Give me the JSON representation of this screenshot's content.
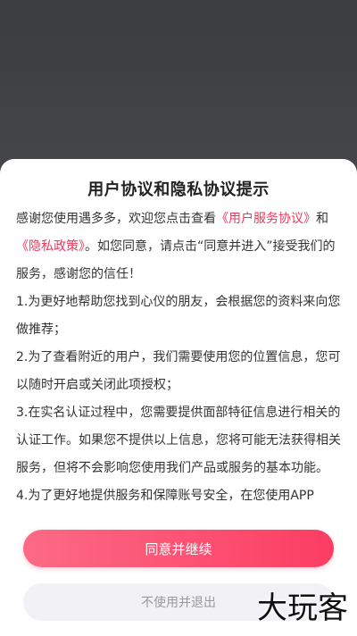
{
  "dialog": {
    "title": "用户协议和隐私协议提示",
    "intro": {
      "text_1": "感谢您使用遇多多，欢迎您点击查看",
      "link_user_agreement": "《用户服务协议》",
      "text_2": "和",
      "link_privacy_policy": "《隐私政策》",
      "text_3": "。如您同意，请点击“同意并进入”接受我们的服务，感谢您的信任！"
    },
    "items": [
      "1.为更好地帮助您找到心仪的朋友，会根据您的资料来向您做推荐；",
      "2.为了查看附近的用户，我们需要使用您的位置信息，您可以随时开启或关闭此项授权；",
      "3.在实名认证过程中，您需要提供面部特征信息进行相关的认证工作。如果您不提供以上信息，您将可能无法获得相关服务，但将不会影响您使用我们产品或服务的基本功能。",
      "4.为了更好地提供服务和保障账号安全，在您使用APP"
    ],
    "agree_button": "同意并继续",
    "exit_button": "不使用并退出"
  },
  "watermark": "大玩客",
  "colors": {
    "accent": "#fb3d63",
    "accent_start": "#fd6a86",
    "link": "#f0365a",
    "exit_button_bg": "#f2f2f6",
    "exit_button_text": "#9a9a9e"
  }
}
